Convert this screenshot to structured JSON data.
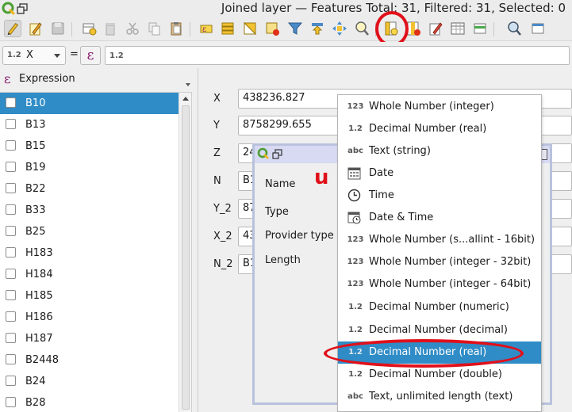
{
  "window": {
    "title": "Joined layer — Features Total: 31, Filtered: 31, Selected: 0"
  },
  "toolbar": {
    "icons": [
      "toggle-editing-icon",
      "multi-edit-icon",
      "save-edits-icon",
      "reload-icon",
      "add-feature-icon",
      "delete-feature-icon",
      "cut-icon",
      "copy-icon",
      "paste-icon",
      "select-by-expression-icon",
      "select-all-icon",
      "invert-selection-icon",
      "deselect-icon",
      "filter-icon",
      "move-selection-to-top-icon",
      "pan-to-selection-icon",
      "zoom-to-selection-icon",
      "new-field-icon",
      "delete-field-icon",
      "organize-columns-icon",
      "field-calculator-icon",
      "conditional-formatting-icon",
      "dock-icon",
      "actions-icon"
    ]
  },
  "expression_bar": {
    "field_type_tag": "1.2",
    "field_name": "X",
    "equals": "=",
    "expression_button": "ε",
    "value": "1.2"
  },
  "list": {
    "header_icon": "ε",
    "header": "Expression",
    "items": [
      "B10",
      "B13",
      "B15",
      "B19",
      "B22",
      "B33",
      "B25",
      "H183",
      "H184",
      "H185",
      "H186",
      "H187",
      "B2448",
      "B24",
      "B28"
    ],
    "selected_index": 0
  },
  "form": {
    "fields": [
      {
        "label": "X",
        "value": "438236.827"
      },
      {
        "label": "Y",
        "value": "8758299.655"
      },
      {
        "label": "Z",
        "value": "24"
      },
      {
        "label": "N",
        "value": "B1"
      },
      {
        "label": "Y_2",
        "value": "87"
      },
      {
        "label": "X_2",
        "value": "43"
      },
      {
        "label": "N_2",
        "value": "B1"
      }
    ]
  },
  "dialog": {
    "labels": [
      "Name",
      "Type",
      "Provider type",
      "Length"
    ],
    "annotation": "u"
  },
  "type_menu": {
    "items": [
      {
        "tag": "123",
        "label": "Whole Number (integer)"
      },
      {
        "tag": "1.2",
        "label": "Decimal Number (real)"
      },
      {
        "tag": "abc",
        "label": "Text (string)"
      },
      {
        "icon": "calendar-icon",
        "label": "Date"
      },
      {
        "icon": "clock-icon",
        "label": "Time"
      },
      {
        "icon": "datetime-icon",
        "label": "Date & Time"
      },
      {
        "tag": "123",
        "label": "Whole Number (s...allint - 16bit)"
      },
      {
        "tag": "123",
        "label": "Whole Number (integer - 32bit)"
      },
      {
        "tag": "123",
        "label": "Whole Number (integer - 64bit)"
      },
      {
        "tag": "1.2",
        "label": "Decimal Number (numeric)"
      },
      {
        "tag": "1.2",
        "label": "Decimal Number (decimal)"
      },
      {
        "tag": "1.2",
        "label": "Decimal Number (real)"
      },
      {
        "tag": "1.2",
        "label": "Decimal Number (double)"
      },
      {
        "tag": "abc",
        "label": "Text, unlimited length (text)"
      }
    ],
    "highlighted_index": 11
  },
  "colors": {
    "selection": "#308cc6",
    "annotation_red": "#e0101a",
    "expression_purple": "#8a1a6e"
  }
}
